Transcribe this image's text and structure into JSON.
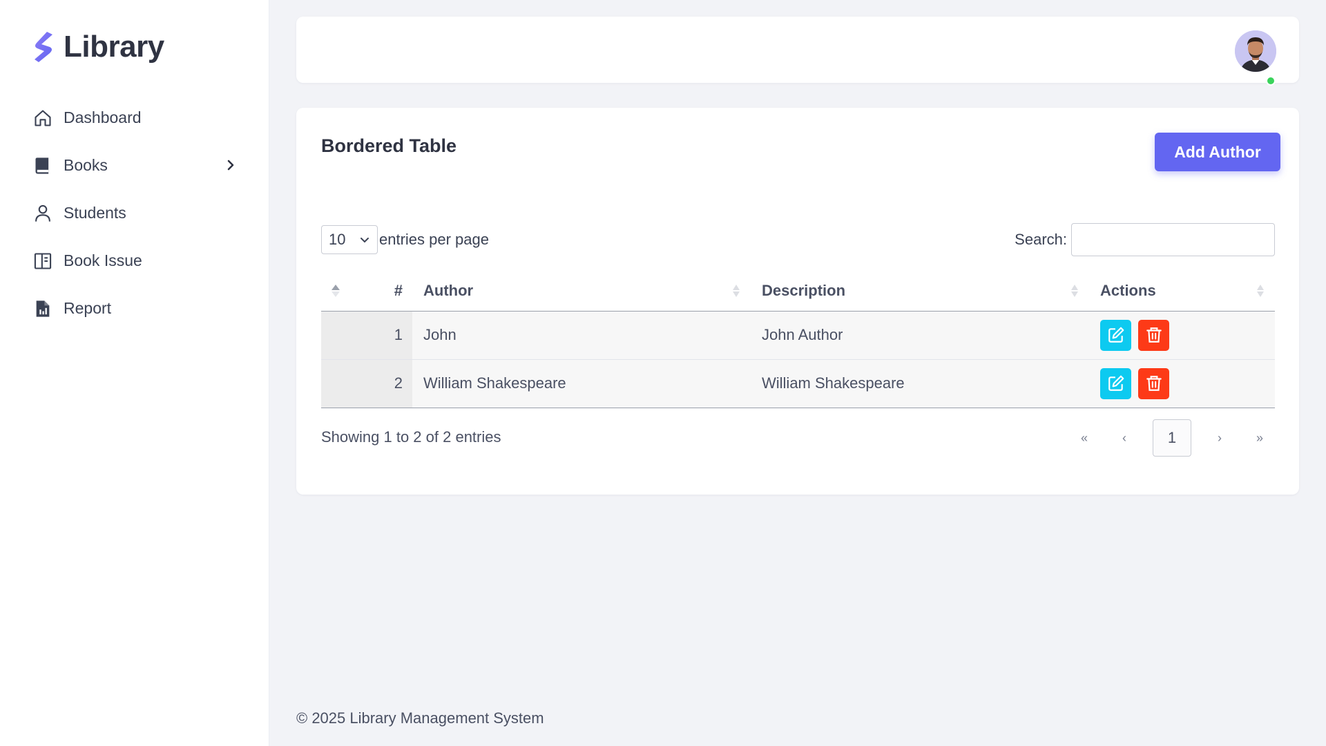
{
  "brand": {
    "name": "Library"
  },
  "sidebar": {
    "items": [
      {
        "label": "Dashboard",
        "icon": "home-icon"
      },
      {
        "label": "Books",
        "icon": "book-icon",
        "has_submenu": true
      },
      {
        "label": "Students",
        "icon": "user-icon"
      },
      {
        "label": "Book Issue",
        "icon": "book-open-icon"
      },
      {
        "label": "Report",
        "icon": "report-icon"
      }
    ]
  },
  "card": {
    "title": "Bordered Table",
    "add_button": "Add Author"
  },
  "table_controls": {
    "page_length": "10",
    "page_length_label": "entries per page",
    "search_label": "Search:",
    "search_value": ""
  },
  "table": {
    "columns": [
      "#",
      "Author",
      "Description",
      "Actions"
    ],
    "rows": [
      {
        "num": "1",
        "author": "John",
        "description": "John Author"
      },
      {
        "num": "2",
        "author": "William Shakespeare",
        "description": "William Shakespeare"
      }
    ]
  },
  "pagination": {
    "first": "«",
    "prev": "‹",
    "current": "1",
    "next": "›",
    "last": "»",
    "info": "Showing 1 to 2 of 2 entries"
  },
  "footer": {
    "text": "© 2025 Library Management System"
  },
  "colors": {
    "accent": "#6366f1",
    "edit": "#0dcaf0",
    "delete": "#fd3a17",
    "online": "#3ad35b"
  }
}
